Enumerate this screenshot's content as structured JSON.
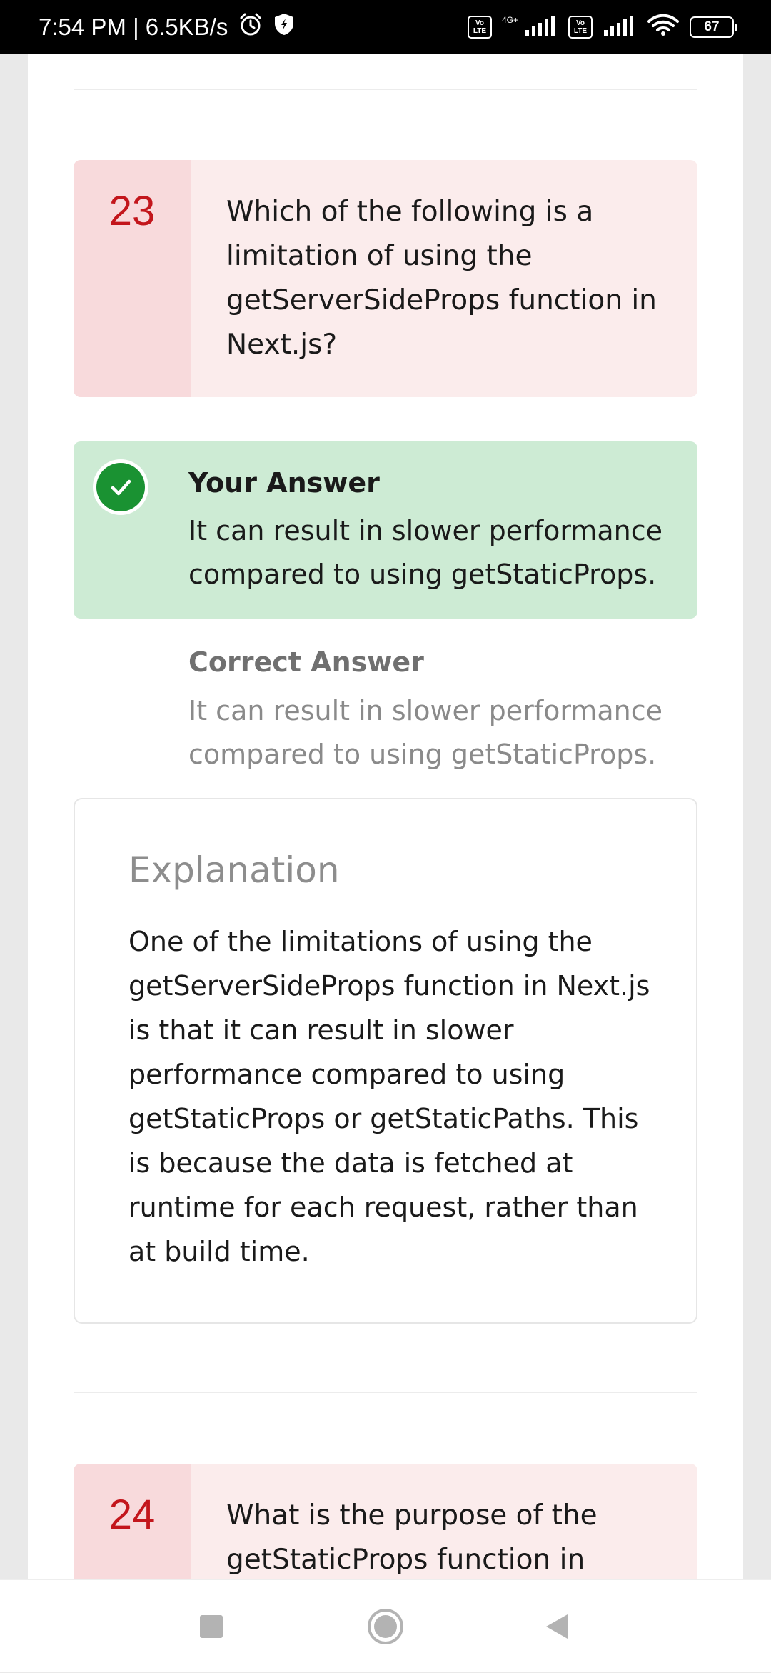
{
  "status_bar": {
    "time_speed": "7:54 PM | 6.5KB/s",
    "volte1": [
      "Vo",
      "LTE"
    ],
    "network_type": "4G+",
    "volte2": [
      "Vo",
      "LTE"
    ],
    "battery": "67"
  },
  "question23": {
    "number": "23",
    "text": "Which of the following is a limitation of using the getServerSideProps function in Next.js?"
  },
  "your_answer": {
    "title": "Your Answer",
    "text": "It can result in slower performance compared to using getStaticProps.",
    "status_color": "#1a9232"
  },
  "correct_answer": {
    "title": "Correct Answer",
    "text": "It can result in slower performance compared to using getStaticProps."
  },
  "explanation": {
    "title": "Explanation",
    "body": "One of the limitations of using the getServerSideProps function in Next.js is that it can result in slower performance compared to using getStaticProps or getStaticPaths. This is because the data is fetched at runtime for each request, rather than at build time."
  },
  "question24": {
    "number": "24",
    "text": "What is the purpose of the getStaticProps function in Next.js?"
  },
  "nav_icons": [
    "recent-apps-icon",
    "home-icon",
    "back-icon"
  ]
}
